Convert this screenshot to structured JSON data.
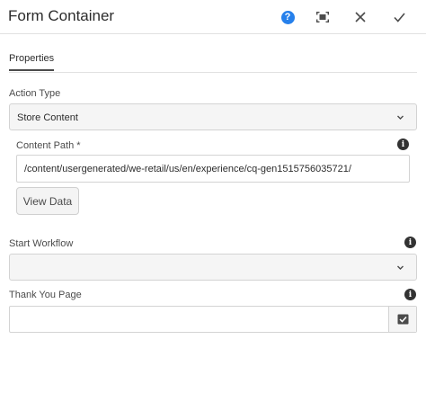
{
  "header": {
    "title": "Form Container"
  },
  "tabs": [
    {
      "label": "Properties"
    }
  ],
  "fields": {
    "action_type": {
      "label": "Action Type",
      "value": "Store Content"
    },
    "content_path": {
      "label": "Content Path *",
      "value": "/content/usergenerated/we-retail/us/en/experience/cq-gen1515756035721/"
    },
    "view_data": {
      "label": "View Data"
    },
    "start_workflow": {
      "label": "Start Workflow",
      "value": ""
    },
    "thank_you_page": {
      "label": "Thank You Page",
      "value": ""
    }
  },
  "colors": {
    "accent": "#2680eb",
    "border": "#d3d3d3",
    "text": "#323232"
  },
  "icons": {
    "help": "help-icon",
    "fullscreen": "fullscreen-icon",
    "close": "close-icon",
    "done": "checkmark-icon",
    "info": "info-icon",
    "chevron": "chevron-down-icon",
    "picker": "path-picker-icon"
  }
}
